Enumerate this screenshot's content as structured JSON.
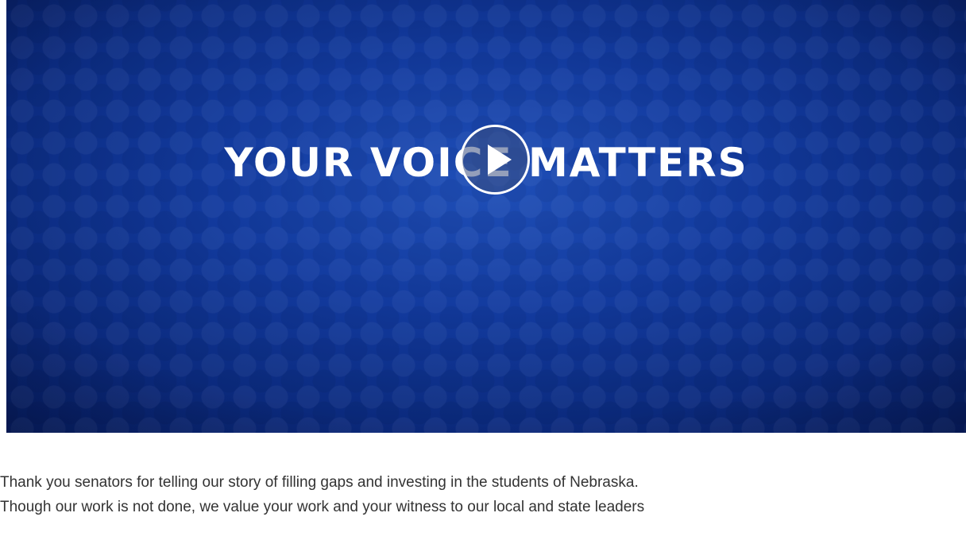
{
  "video": {
    "headline": "YOUR VOICE MATTERS",
    "play_icon": "play-icon",
    "colors": {
      "background_center": "#1f4fb8",
      "background_edge": "#061c5c",
      "headline": "#ffffff"
    }
  },
  "caption": {
    "line1": "Thank you senators for telling our story of filling gaps and investing in the students of Nebraska.",
    "line2": "Though our work is not done, we value your work and your witness to our local and state leaders"
  }
}
